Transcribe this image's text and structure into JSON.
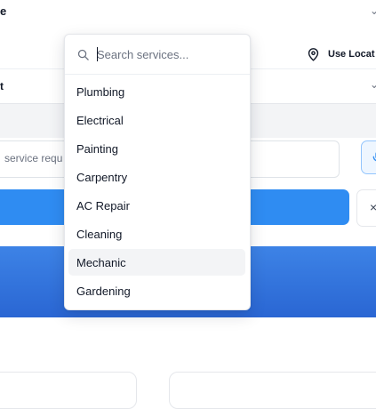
{
  "background_form": {
    "top_field_fragment": "e",
    "location_button_label": "Use Locat",
    "category_field_fragment": "t",
    "description_placeholder_fragment": "service requ",
    "close_label": "×"
  },
  "dropdown": {
    "search_placeholder": "Search services...",
    "options": [
      {
        "label": "Plumbing"
      },
      {
        "label": "Electrical"
      },
      {
        "label": "Painting"
      },
      {
        "label": "Carpentry"
      },
      {
        "label": "AC Repair"
      },
      {
        "label": "Cleaning"
      },
      {
        "label": "Mechanic",
        "highlighted": true
      },
      {
        "label": "Gardening"
      }
    ]
  },
  "colors": {
    "primary_button": "#2f8cf2",
    "hero_banner": "#2a66d3",
    "highlight": "#f3f4f6"
  }
}
